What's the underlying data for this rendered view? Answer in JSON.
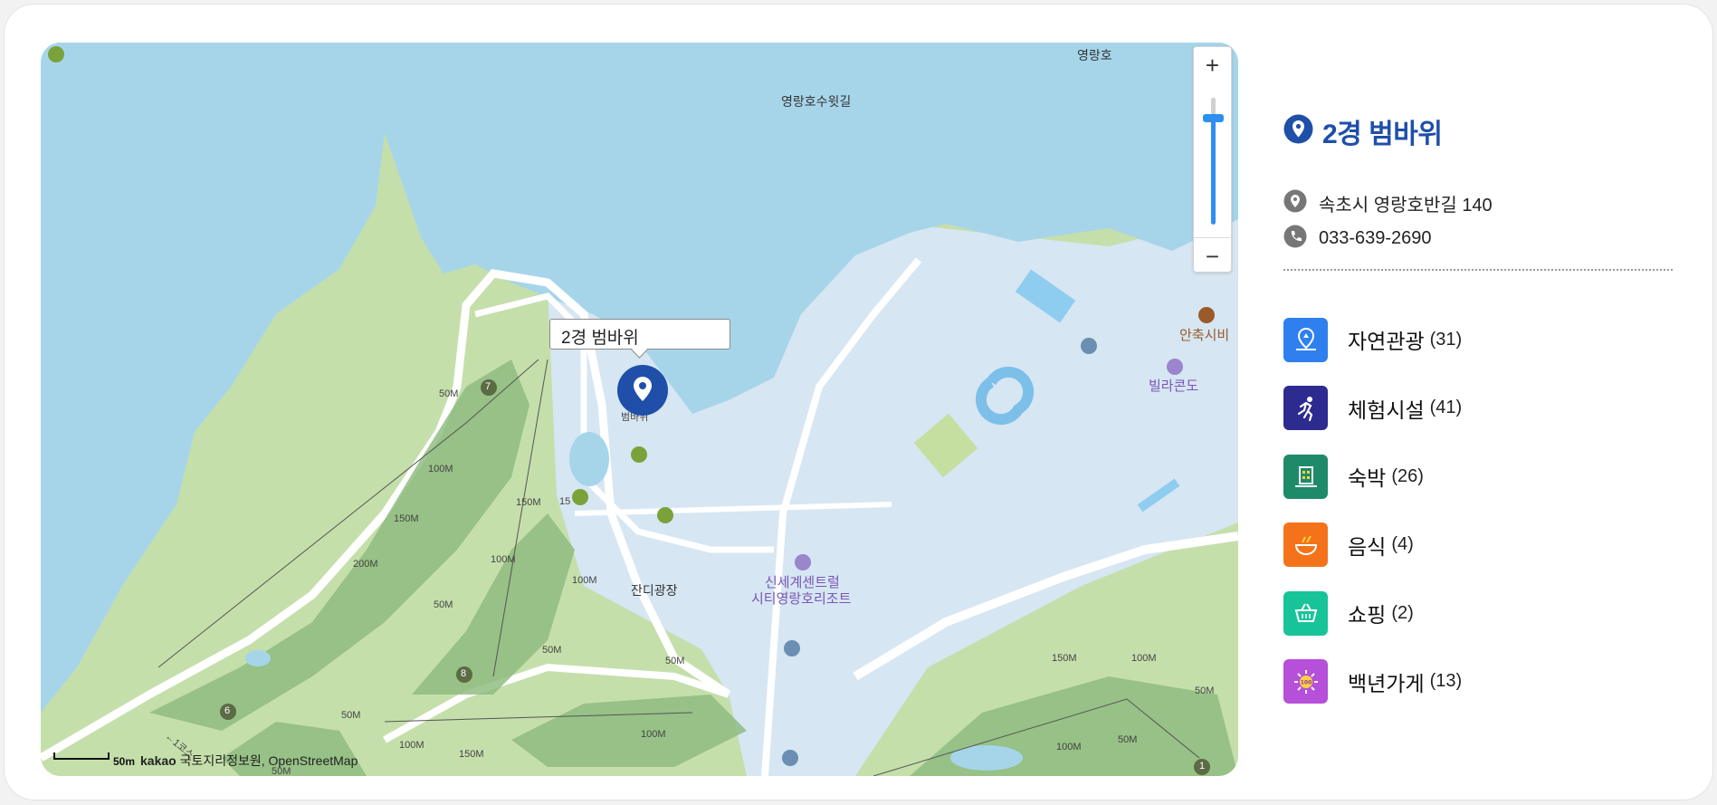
{
  "place": {
    "title": "2경 범바위",
    "address": "속초시 영랑호반길 140",
    "phone": "033-639-2690",
    "accent_color": "#1f4fa8"
  },
  "map": {
    "marker_label": "2경 범바위",
    "marker_under_label": "범바위",
    "labels": {
      "lake_top": "영랑호",
      "lake_road": "영랑호수윗길",
      "grass_plaza": "잔디광장",
      "resort_line1": "신세계센트럴",
      "resort_line2": "시티영랑호리조트",
      "villa": "빌라콘도",
      "info": "안축시비"
    },
    "distance_markers": [
      "50M",
      "100M",
      "150M",
      "200M",
      "100M",
      "150M",
      "100M",
      "50M",
      "50M",
      "100M",
      "50M",
      "50M",
      "100M",
      "150M",
      "50M",
      "150M",
      "100M",
      "50M",
      "100M",
      "50M",
      "15"
    ],
    "hole_numbers": [
      "7",
      "8",
      "6",
      "1"
    ],
    "zoom_in": "+",
    "zoom_out": "−",
    "scale_label": "50m",
    "attribution_brand": "kakao",
    "attribution_text": "국토지리정보원, OpenStreetMap",
    "arrow_hint": "←1코스"
  },
  "categories": [
    {
      "name": "자연관광",
      "count": "(31)",
      "color": "#2f80ee",
      "icon": "nature-pin-icon"
    },
    {
      "name": "체험시설",
      "count": "(41)",
      "color": "#2d2b8f",
      "icon": "running-person-icon"
    },
    {
      "name": "숙박",
      "count": "(26)",
      "color": "#1e8a6a",
      "icon": "hotel-building-icon"
    },
    {
      "name": "음식",
      "count": "(4)",
      "color": "#f4731a",
      "icon": "food-bowl-icon"
    },
    {
      "name": "쇼핑",
      "count": "(2)",
      "color": "#17c49a",
      "icon": "shopping-basket-icon"
    },
    {
      "name": "백년가게",
      "count": "(13)",
      "color": "#b64fd9",
      "icon": "hundred-year-store-icon"
    }
  ]
}
